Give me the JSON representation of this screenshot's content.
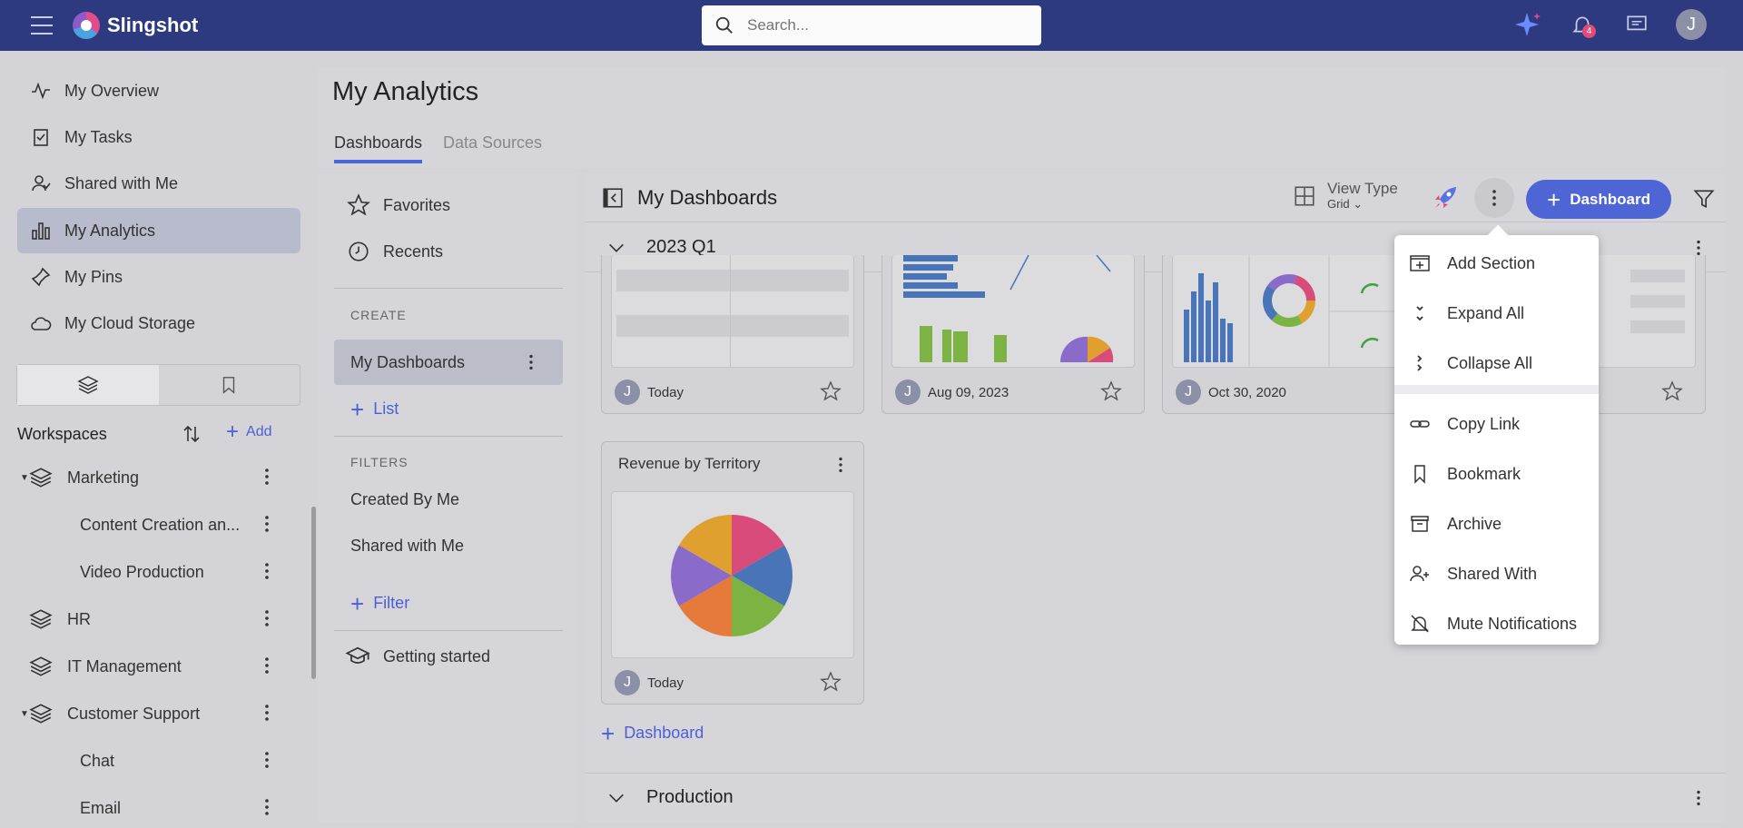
{
  "app": {
    "name": "Slingshot",
    "notification_count": "4",
    "user_initial": "J"
  },
  "search": {
    "placeholder": "Search..."
  },
  "sidebar": {
    "items": [
      {
        "label": "My Overview",
        "icon": "activity-icon"
      },
      {
        "label": "My Tasks",
        "icon": "task-icon"
      },
      {
        "label": "Shared with Me",
        "icon": "shared-user-icon"
      },
      {
        "label": "My Analytics",
        "icon": "analytics-icon",
        "active": true
      },
      {
        "label": "My Pins",
        "icon": "pin-icon"
      },
      {
        "label": "My Cloud Storage",
        "icon": "cloud-icon"
      }
    ],
    "workspaces_label": "Workspaces",
    "add_label": "Add",
    "workspaces": [
      {
        "label": "Marketing"
      },
      {
        "label": "Content Creation an..."
      },
      {
        "label": "Video Production"
      },
      {
        "label": "HR"
      },
      {
        "label": "IT Management"
      },
      {
        "label": "Customer Support"
      },
      {
        "label": "Chat"
      },
      {
        "label": "Email"
      }
    ]
  },
  "header": {
    "title": "My Analytics",
    "tabs": [
      "Dashboards",
      "Data Sources"
    ]
  },
  "midpanel": {
    "favorites": "Favorites",
    "recents": "Recents",
    "create_label": "CREATE",
    "my_dashboards": "My Dashboards",
    "list_link": "List",
    "filters_label": "FILTERS",
    "created_by_me": "Created By Me",
    "shared_with_me": "Shared with Me",
    "filter_link": "Filter",
    "getting_started": "Getting started"
  },
  "main": {
    "title": "My Dashboards",
    "view_type": "View Type",
    "view_type_value": "Grid",
    "add_dashboard": "Dashboard",
    "sections": [
      "2023 Q1",
      "Production"
    ],
    "cards_top": [
      {
        "date": "Today"
      },
      {
        "date": "Aug 09, 2023"
      },
      {
        "date": "Oct 30, 2020"
      }
    ],
    "card_revenue": {
      "title": "Revenue by Territory",
      "date": "Today"
    },
    "add_dashboard_link": "Dashboard"
  },
  "menu": {
    "items": [
      "Add Section",
      "Expand All",
      "Collapse All",
      "Copy Link",
      "Bookmark",
      "Archive",
      "Shared With",
      "Mute Notifications"
    ]
  },
  "colors": {
    "brand": "#2d3a7f",
    "accent": "#4e65d6",
    "badge": "#e24c78"
  }
}
